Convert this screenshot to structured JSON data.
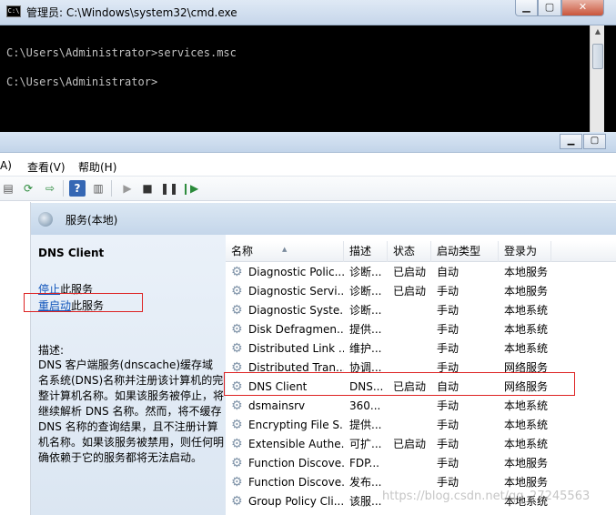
{
  "cmd": {
    "title": "管理员: C:\\Windows\\system32\\cmd.exe",
    "icon": "cmd-icon",
    "icon_text": "C:\\",
    "min_label": "▁",
    "max_label": "▢",
    "close_label": "✕",
    "lines": "C:\\Users\\Administrator>services.msc\nC:\\Users\\Administrator>"
  },
  "services_window": {
    "min_label": "▁",
    "max_label": "▢",
    "menu": [
      "A)",
      "查看(V)",
      "帮助(H)"
    ],
    "header_title": "服务(本地)",
    "selected_service": "DNS Client",
    "stop_link": "停止",
    "stop_suffix": "此服务",
    "restart_link": "重启动",
    "restart_suffix": "此服务",
    "desc_label": "描述:",
    "desc_text": "DNS 客户端服务(dnscache)缓存域名系统(DNS)名称并注册该计算机的完整计算机名称。如果该服务被停止，将继续解析 DNS 名称。然而，将不缓存 DNS 名称的查询结果，且不注册计算机名称。如果该服务被禁用，则任何明确依赖于它的服务都将无法启动。"
  },
  "columns": [
    "名称",
    "描述",
    "状态",
    "启动类型",
    "登录为"
  ],
  "services": [
    {
      "name": "Diagnostic Polic...",
      "desc": "诊断...",
      "status": "已启动",
      "startup": "自动",
      "logon": "本地服务"
    },
    {
      "name": "Diagnostic Servi...",
      "desc": "诊断...",
      "status": "已启动",
      "startup": "手动",
      "logon": "本地服务"
    },
    {
      "name": "Diagnostic Syste...",
      "desc": "诊断...",
      "status": "",
      "startup": "手动",
      "logon": "本地系统"
    },
    {
      "name": "Disk Defragmen...",
      "desc": "提供...",
      "status": "",
      "startup": "手动",
      "logon": "本地系统"
    },
    {
      "name": "Distributed Link ...",
      "desc": "维护...",
      "status": "",
      "startup": "手动",
      "logon": "本地系统"
    },
    {
      "name": "Distributed Tran...",
      "desc": "协调...",
      "status": "",
      "startup": "手动",
      "logon": "网络服务"
    },
    {
      "name": "DNS Client",
      "desc": "DNS...",
      "status": "已启动",
      "startup": "自动",
      "logon": "网络服务"
    },
    {
      "name": "dsmainsrv",
      "desc": "360...",
      "status": "",
      "startup": "手动",
      "logon": "本地系统"
    },
    {
      "name": "Encrypting File S...",
      "desc": "提供...",
      "status": "",
      "startup": "手动",
      "logon": "本地系统"
    },
    {
      "name": "Extensible Authe...",
      "desc": "可扩...",
      "status": "已启动",
      "startup": "手动",
      "logon": "本地系统"
    },
    {
      "name": "Function Discove...",
      "desc": "FDP...",
      "status": "",
      "startup": "手动",
      "logon": "本地服务"
    },
    {
      "name": "Function Discove...",
      "desc": "发布...",
      "status": "",
      "startup": "手动",
      "logon": "本地服务"
    },
    {
      "name": "Group Policy Cli...",
      "desc": "该服...",
      "status": "",
      "startup": "",
      "logon": "本地系统"
    }
  ],
  "watermark": "https://blog.csdn.net/qq_27245563",
  "colors": {
    "highlight": "#dd2222",
    "link": "#1155bb"
  }
}
